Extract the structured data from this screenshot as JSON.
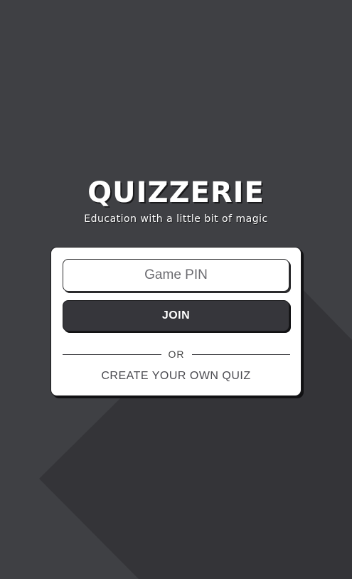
{
  "brand": {
    "title": "QUIZZERIE",
    "tagline": "Education with a little bit of magic"
  },
  "form": {
    "pin_placeholder": "Game PIN",
    "join_label": "JOIN",
    "divider_text": "OR",
    "create_label": "CREATE YOUR OWN QUIZ"
  },
  "colors": {
    "background": "#3f4044",
    "background_shape": "#343438",
    "card": "#ffffff",
    "button": "#36363b"
  }
}
